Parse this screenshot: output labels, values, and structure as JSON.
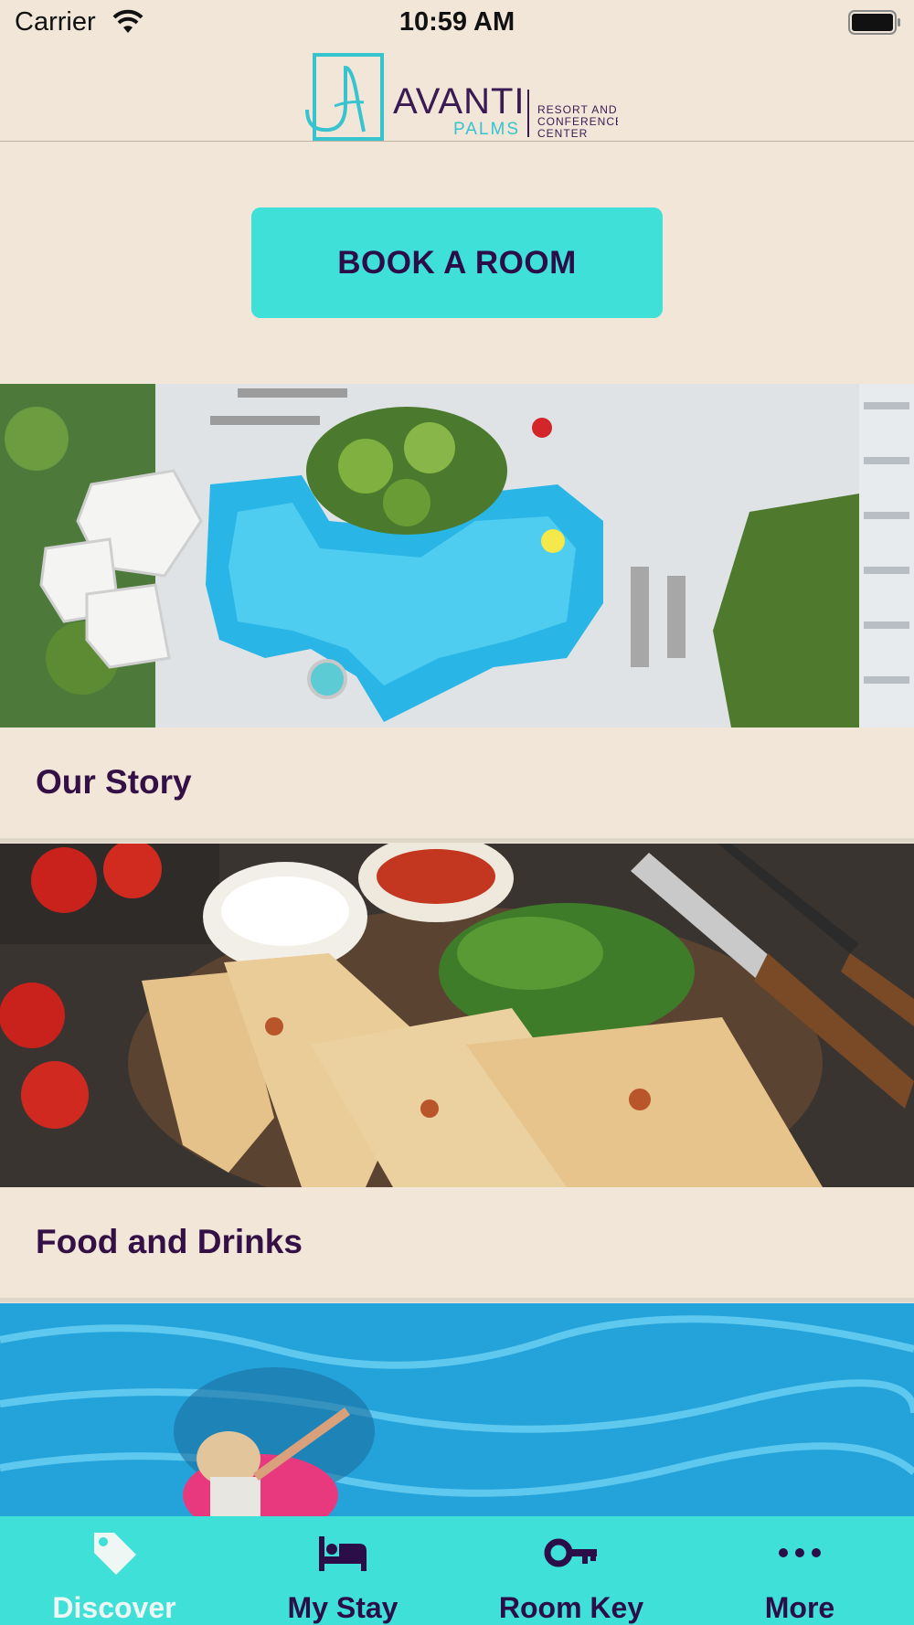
{
  "status_bar": {
    "carrier": "Carrier",
    "time": "10:59 AM"
  },
  "header": {
    "brand_name": "AVANTI",
    "brand_sub": "PALMS",
    "brand_tag_1": "RESORT AND",
    "brand_tag_2": "CONFERENCE",
    "brand_tag_3": "CENTER"
  },
  "book_button": {
    "label": "BOOK A ROOM"
  },
  "cards": [
    {
      "title": "Our Story",
      "image": "aerial-pool-image"
    },
    {
      "title": "Food and Drinks",
      "image": "quesadilla-image"
    },
    {
      "title": "",
      "image": "pool-float-image"
    }
  ],
  "tab_bar": {
    "items": [
      {
        "label": "Discover",
        "icon": "tag-icon",
        "active": true
      },
      {
        "label": "My Stay",
        "icon": "bed-icon",
        "active": false
      },
      {
        "label": "Room Key",
        "icon": "key-icon",
        "active": false
      },
      {
        "label": "More",
        "icon": "more-dots-icon",
        "active": false
      }
    ]
  },
  "colors": {
    "background": "#f1e6d8",
    "accent": "#3ee0d8",
    "text_dark": "#2b0e47",
    "tab_active": "#eef7f3"
  }
}
